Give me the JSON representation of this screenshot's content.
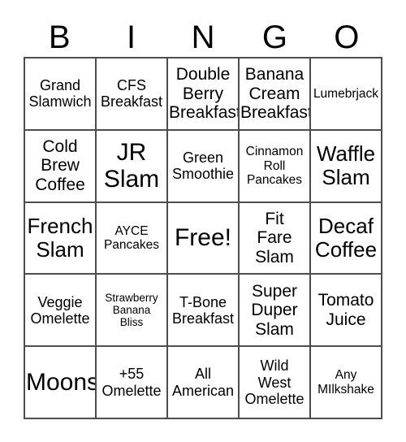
{
  "card": {
    "header_letters": [
      "B",
      "I",
      "N",
      "G",
      "O"
    ],
    "columns": 5,
    "rows": 5,
    "free_space_label": "Free!",
    "border_color": "#4d4d4d",
    "text_color": "#000000",
    "background_color": "#ffffff",
    "cells": [
      {
        "text": "Grand\nSlamwich",
        "size": "md",
        "row": 1,
        "col": 1
      },
      {
        "text": "CFS\nBreakfast",
        "size": "md",
        "row": 1,
        "col": 2
      },
      {
        "text": "Double\nBerry\nBreakfast",
        "size": "lg",
        "row": 1,
        "col": 3
      },
      {
        "text": "Banana\nCream\nBreakfast",
        "size": "lg",
        "row": 1,
        "col": 4
      },
      {
        "text": "Lumebrjack",
        "size": "sm",
        "row": 1,
        "col": 5
      },
      {
        "text": "Cold\nBrew\nCoffee",
        "size": "lg",
        "row": 2,
        "col": 1
      },
      {
        "text": "JR\nSlam",
        "size": "xxl",
        "row": 2,
        "col": 2
      },
      {
        "text": "Green\nSmoothie",
        "size": "md",
        "row": 2,
        "col": 3
      },
      {
        "text": "Cinnamon\nRoll\nPancakes",
        "size": "sm",
        "row": 2,
        "col": 4
      },
      {
        "text": "Waffle\nSlam",
        "size": "xl",
        "row": 2,
        "col": 5
      },
      {
        "text": "French\nSlam",
        "size": "xl",
        "row": 3,
        "col": 1
      },
      {
        "text": "AYCE\nPancakes",
        "size": "sm",
        "row": 3,
        "col": 2
      },
      {
        "text": "Free!",
        "size": "xxl",
        "row": 3,
        "col": 3
      },
      {
        "text": "Fit\nFare\nSlam",
        "size": "lg",
        "row": 3,
        "col": 4
      },
      {
        "text": "Decaf\nCoffee",
        "size": "xl",
        "row": 3,
        "col": 5
      },
      {
        "text": "Veggie\nOmelette",
        "size": "md",
        "row": 4,
        "col": 1
      },
      {
        "text": "Strawberry\nBanana\nBliss",
        "size": "xs",
        "row": 4,
        "col": 2
      },
      {
        "text": "T-Bone\nBreakfast",
        "size": "md",
        "row": 4,
        "col": 3
      },
      {
        "text": "Super\nDuper\nSlam",
        "size": "lg",
        "row": 4,
        "col": 4
      },
      {
        "text": "Tomato\nJuice",
        "size": "lg",
        "row": 4,
        "col": 5
      },
      {
        "text": "Moons",
        "size": "xxl",
        "row": 5,
        "col": 1
      },
      {
        "text": "+55\nOmelette",
        "size": "md",
        "row": 5,
        "col": 2
      },
      {
        "text": "All\nAmerican",
        "size": "md",
        "row": 5,
        "col": 3
      },
      {
        "text": "Wild\nWest\nOmelette",
        "size": "md",
        "row": 5,
        "col": 4
      },
      {
        "text": "Any\nMIlkshake",
        "size": "sm",
        "row": 5,
        "col": 5
      }
    ]
  }
}
